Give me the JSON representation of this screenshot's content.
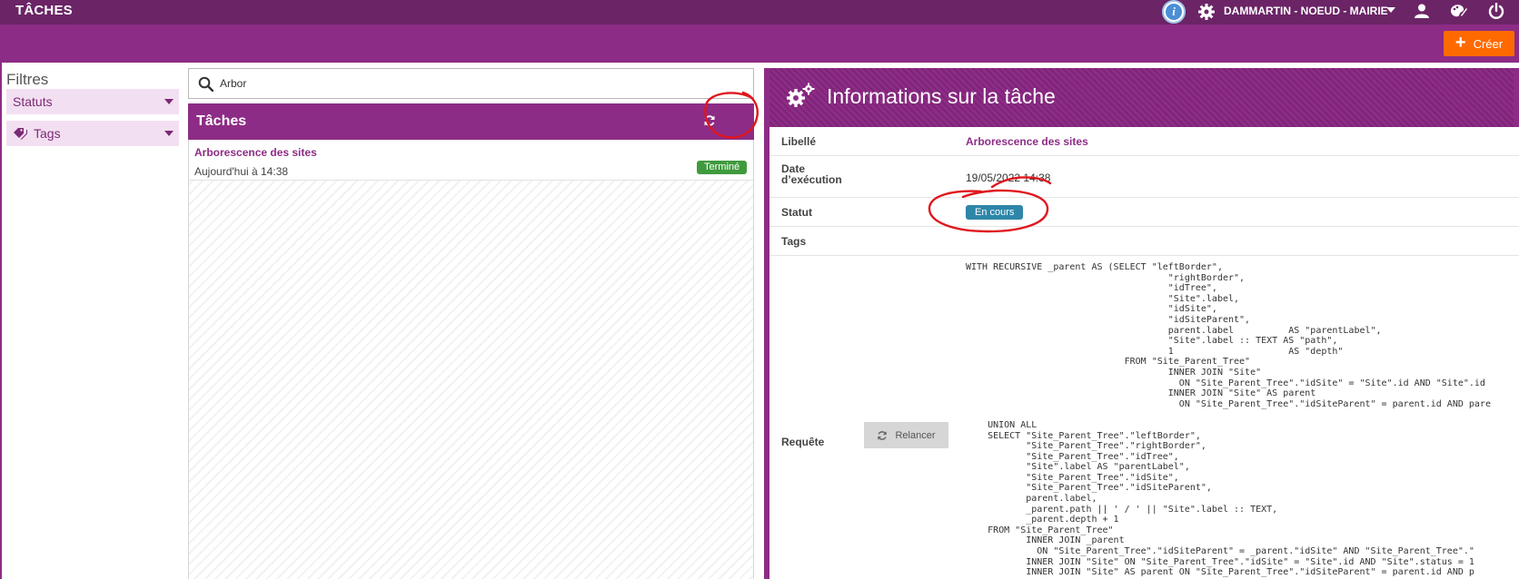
{
  "app": {
    "title": "TÂCHES",
    "site_selector": "DAMMARTIN - NOEUD - MAIRIE",
    "create_label": "Créer",
    "accent_color": "#8d2c86",
    "topbar_color": "#6b2466",
    "create_color": "#ff6a00"
  },
  "filters": {
    "title": "Filtres",
    "items": [
      {
        "label": "Statuts",
        "icon": "chevron-down-icon"
      },
      {
        "label": "Tags",
        "icon": "tags-icon"
      }
    ]
  },
  "search": {
    "value": "Arbor",
    "placeholder": ""
  },
  "tasks": {
    "title": "Tâches",
    "items": [
      {
        "name": "Arborescence des sites",
        "date": "Aujourd'hui à 14:38",
        "status": "Terminé",
        "status_color": "#3f9a3d"
      }
    ]
  },
  "details": {
    "title": "Informations sur la tâche",
    "rows": {
      "libelle": {
        "label": "Libellé",
        "value": "Arborescence des sites"
      },
      "date": {
        "label": "Date\nd’exécution",
        "value": "19/05/2022 14:38"
      },
      "statut": {
        "label": "Statut",
        "value": "En cours",
        "color": "#2e86a9"
      },
      "tags": {
        "label": "Tags",
        "value": ""
      },
      "requete": {
        "label": "Requête",
        "relaunch_label": "Relancer",
        "sql": "WITH RECURSIVE _parent AS (SELECT \"leftBorder\",\n                                     \"rightBorder\",\n                                     \"idTree\",\n                                     \"Site\".label,\n                                     \"idSite\",\n                                     \"idSiteParent\",\n                                     parent.label          AS \"parentLabel\",\n                                     \"Site\".label :: TEXT AS \"path\",\n                                     1                     AS \"depth\"\n                             FROM \"Site_Parent_Tree\"\n                                     INNER JOIN \"Site\"\n                                       ON \"Site_Parent_Tree\".\"idSite\" = \"Site\".id AND \"Site\".id\n                                     INNER JOIN \"Site\" AS parent\n                                       ON \"Site_Parent_Tree\".\"idSiteParent\" = parent.id AND pare\n\n    UNION ALL\n    SELECT \"Site_Parent_Tree\".\"leftBorder\",\n           \"Site_Parent_Tree\".\"rightBorder\",\n           \"Site_Parent_Tree\".\"idTree\",\n           \"Site\".label AS \"parentLabel\",\n           \"Site_Parent_Tree\".\"idSite\",\n           \"Site_Parent_Tree\".\"idSiteParent\",\n           parent.label,\n           _parent.path || ' / ' || \"Site\".label :: TEXT,\n           _parent.depth + 1\n    FROM \"Site_Parent_Tree\"\n           INNER JOIN _parent\n             ON \"Site_Parent_Tree\".\"idSiteParent\" = _parent.\"idSite\" AND \"Site_Parent_Tree\".\"\n           INNER JOIN \"Site\" ON \"Site_Parent_Tree\".\"idSite\" = \"Site\".id AND \"Site\".status = 1\n           INNER JOIN \"Site\" AS parent ON \"Site_Parent_Tree\".\"idSiteParent\" = parent.id AND p"
      }
    }
  }
}
